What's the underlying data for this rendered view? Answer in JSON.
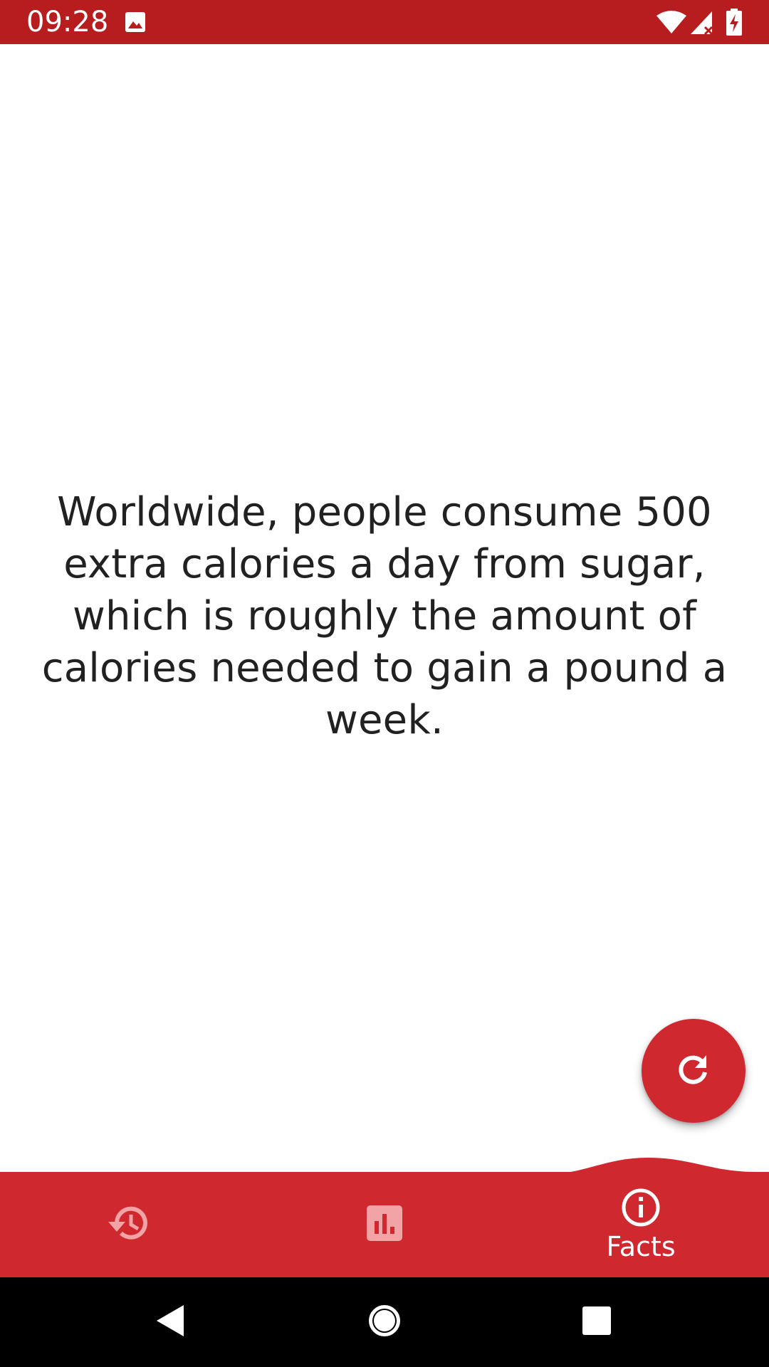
{
  "status_bar": {
    "time": "09:28",
    "icons": [
      "image-icon",
      "wifi-icon",
      "signal-icon",
      "battery-charging-icon"
    ]
  },
  "fact": {
    "text": "Worldwide, people consume 500 extra calories a day from sugar, which is roughly the amount of calories needed to gain a pound a week."
  },
  "fab": {
    "icon": "refresh-icon"
  },
  "bottom_nav": {
    "items": [
      {
        "icon": "history-icon",
        "label": "",
        "active": false
      },
      {
        "icon": "bar-chart-icon",
        "label": "",
        "active": false
      },
      {
        "icon": "info-icon",
        "label": "Facts",
        "active": true
      }
    ]
  },
  "system_nav": {
    "buttons": [
      "back-icon",
      "home-icon",
      "recents-icon"
    ]
  },
  "colors": {
    "status_bar": "#b71c1f",
    "accent": "#d0282f",
    "text": "#212121"
  }
}
